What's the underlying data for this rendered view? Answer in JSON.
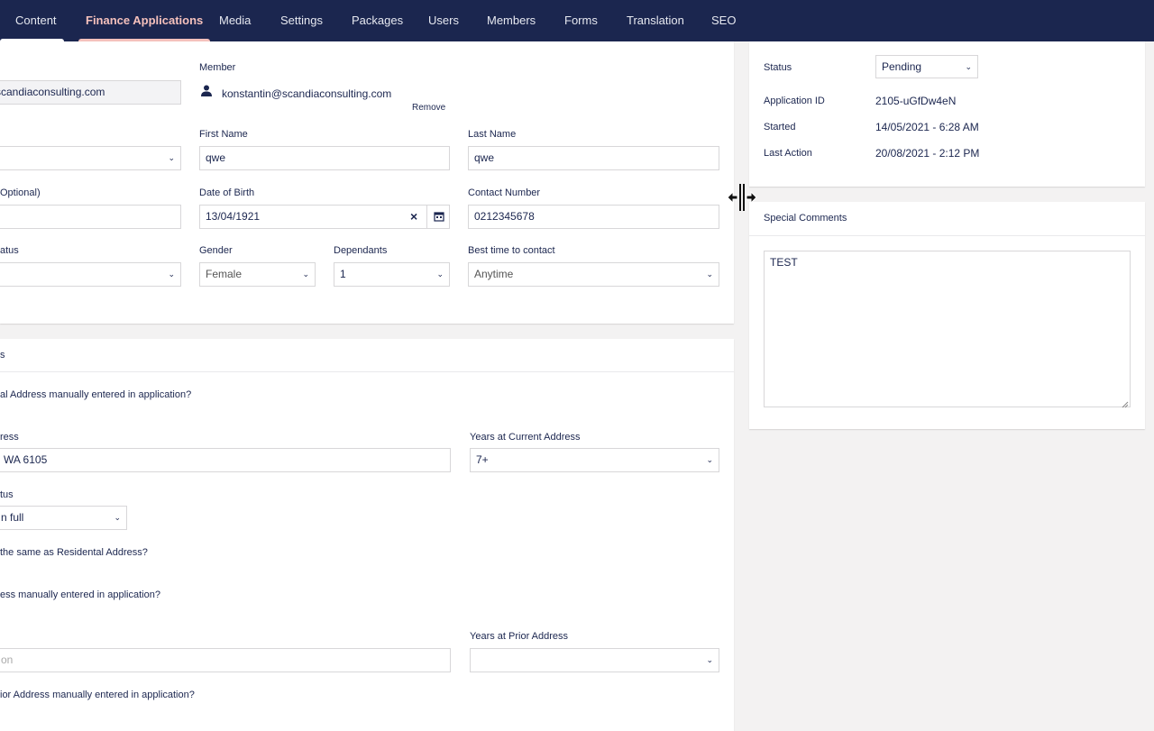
{
  "nav": {
    "tabs": [
      "Content",
      "Finance Applications",
      "Media",
      "Settings",
      "Packages",
      "Users",
      "Members",
      "Forms",
      "Translation",
      "SEO"
    ]
  },
  "applicant": {
    "email_value": "scandiaconsulting.com",
    "member_label": "Member",
    "member_email": "konstantin@scandiaconsulting.com",
    "remove_link": "Remove",
    "first_name_label": "First Name",
    "first_name_value": "qwe",
    "last_name_label": "Last Name",
    "last_name_value": "qwe",
    "optional_label": "Optional)",
    "dob_label": "Date of Birth",
    "dob_value": "13/04/1921",
    "clear_glyph": "×",
    "contact_label": "Contact Number",
    "contact_value": "0212345678",
    "status_partial_label": "atus",
    "gender_label": "Gender",
    "gender_value": "Female",
    "dependants_label": "Dependants",
    "dependants_value": "1",
    "best_time_label": "Best time to contact",
    "best_time_value": "Anytime"
  },
  "address": {
    "section_partial": "s",
    "q_residential_manual": "al Address manually entered in application?",
    "address_partial_label": "ress",
    "address_value": "WA 6105",
    "years_current_label": "Years at Current Address",
    "years_current_value": "7+",
    "tus_label": "tus",
    "ownership_value": "n full",
    "q_same_as_res": "the same as Residental Address?",
    "q_postal_manual": "ess manually entered in application?",
    "years_prior_label": "Years at Prior Address",
    "prior_placeholder": "on",
    "q_prior_manual": "ior Address manually entered in application?"
  },
  "summary": {
    "status_label": "Status",
    "status_value": "Pending",
    "app_id_label": "Application ID",
    "app_id_value": "2105-uGfDw4eN",
    "started_label": "Started",
    "started_value": "14/05/2021 - 6:28 AM",
    "last_action_label": "Last Action",
    "last_action_value": "20/08/2021 - 2:12 PM"
  },
  "comments": {
    "title": "Special Comments",
    "value": "TEST"
  },
  "icons": {
    "chevron": "⌄",
    "user": "user-icon",
    "calendar": "calendar-icon",
    "resize": "resize-cursor-icon"
  },
  "colors": {
    "nav_bg": "#1b264f",
    "active_tab": "#f5c1bc",
    "page_bg": "#f3f2f2"
  }
}
